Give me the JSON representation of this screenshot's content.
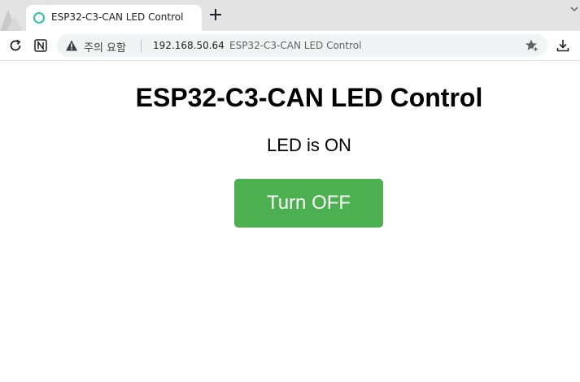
{
  "browser": {
    "tab": {
      "title": "ESP32-C3-CAN LED Control",
      "favicon": "circle-icon"
    },
    "new_tab_icon": "plus-icon",
    "address_bar": {
      "security_label": "주의 요함",
      "host": "192.168.50.64",
      "page_title": "ESP32-C3-CAN LED Control"
    },
    "icons": [
      "reload-icon",
      "extension-n-icon",
      "warning-icon",
      "bookmark-star-icon",
      "download-icon",
      "chevron-down-icon"
    ],
    "colors": {
      "tabstrip": "#e3e3e3",
      "favicon": "#2bc4a6",
      "omnibox": "#f1f3f4"
    }
  },
  "page": {
    "heading": "ESP32-C3-CAN LED Control",
    "status": "LED is ON",
    "button_label": "Turn OFF",
    "colors": {
      "button": "#4caf50",
      "button_text": "#ffffff"
    }
  }
}
